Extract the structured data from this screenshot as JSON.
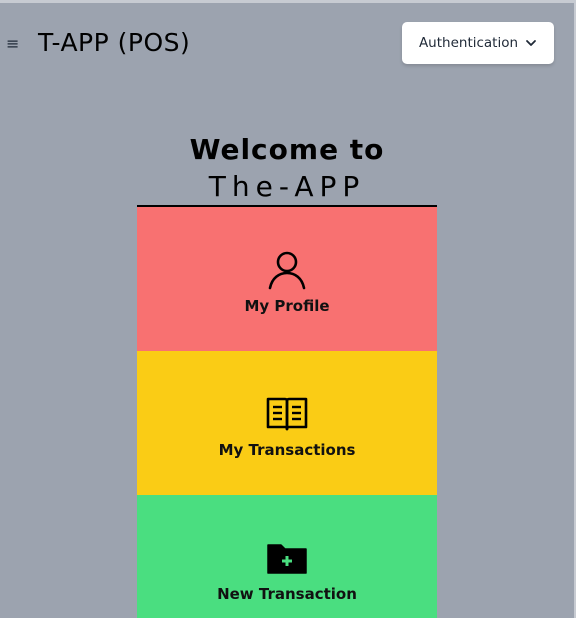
{
  "header": {
    "menu_glyph": "≡",
    "menu_icon": "hamburger-menu-icon",
    "title": "T-APP (POS)",
    "auth_dropdown_label": "Authentication",
    "auth_dropdown_icon": "chevron-down-icon"
  },
  "welcome": {
    "line1": "Welcome to",
    "line2": "The-APP"
  },
  "tiles": [
    {
      "label": "My Profile",
      "icon": "user-icon",
      "color": "#f87171"
    },
    {
      "label": "My Transactions",
      "icon": "open-book-icon",
      "color": "#facc15"
    },
    {
      "label": "New Transaction",
      "icon": "folder-plus-icon",
      "color": "#4ade80"
    }
  ],
  "colors": {
    "background": "#9ca3af",
    "card_divider": "#000000"
  }
}
